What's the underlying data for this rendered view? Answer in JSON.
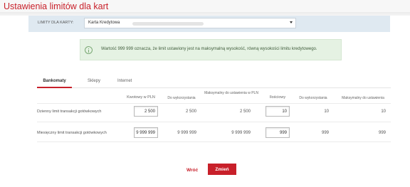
{
  "header": {
    "title": "Ustawienia limitów dla kart"
  },
  "filter": {
    "label": "LIMITY DLA KARTY:",
    "selected": "Karta Kredytowa"
  },
  "info": {
    "text": "Wartość 999 999 oznacza, że limit ustawiony jest na maksymalną wysokość, równą wysokości limitu kredytowego."
  },
  "tabs": [
    {
      "label": "Bankomaty",
      "active": true
    },
    {
      "label": "Sklepy",
      "active": false
    },
    {
      "label": "Internet",
      "active": false
    }
  ],
  "table": {
    "headers": {
      "amount_pln": "Kwotowy w PLN",
      "to_use_1": "Do wykorzystania",
      "max_setting": "Maksymalny do ustawienia w PLN",
      "count": "Ilościowy",
      "to_use_2": "Do wykorzystania",
      "max_setting_2": "Maksymalny do ustawienia"
    },
    "rows": [
      {
        "label": "Dzienny limit transakcji gotówkowych",
        "amount": "2 500",
        "to_use": "2 500",
        "max": "2 500",
        "count": "10",
        "count_to_use": "10",
        "count_max": "10"
      },
      {
        "label": "Miesięczny limit transakcji gotówkowych",
        "amount": "9 999 999",
        "to_use": "9 999 999",
        "max": "9 999 999",
        "count": "999",
        "count_to_use": "999",
        "count_max": "999"
      }
    ]
  },
  "actions": {
    "back": "Wróć",
    "change": "Zmień"
  },
  "colors": {
    "accent": "#c8202a",
    "filter_bg": "#dfe9f1",
    "info_bg": "#e5f2e3"
  }
}
